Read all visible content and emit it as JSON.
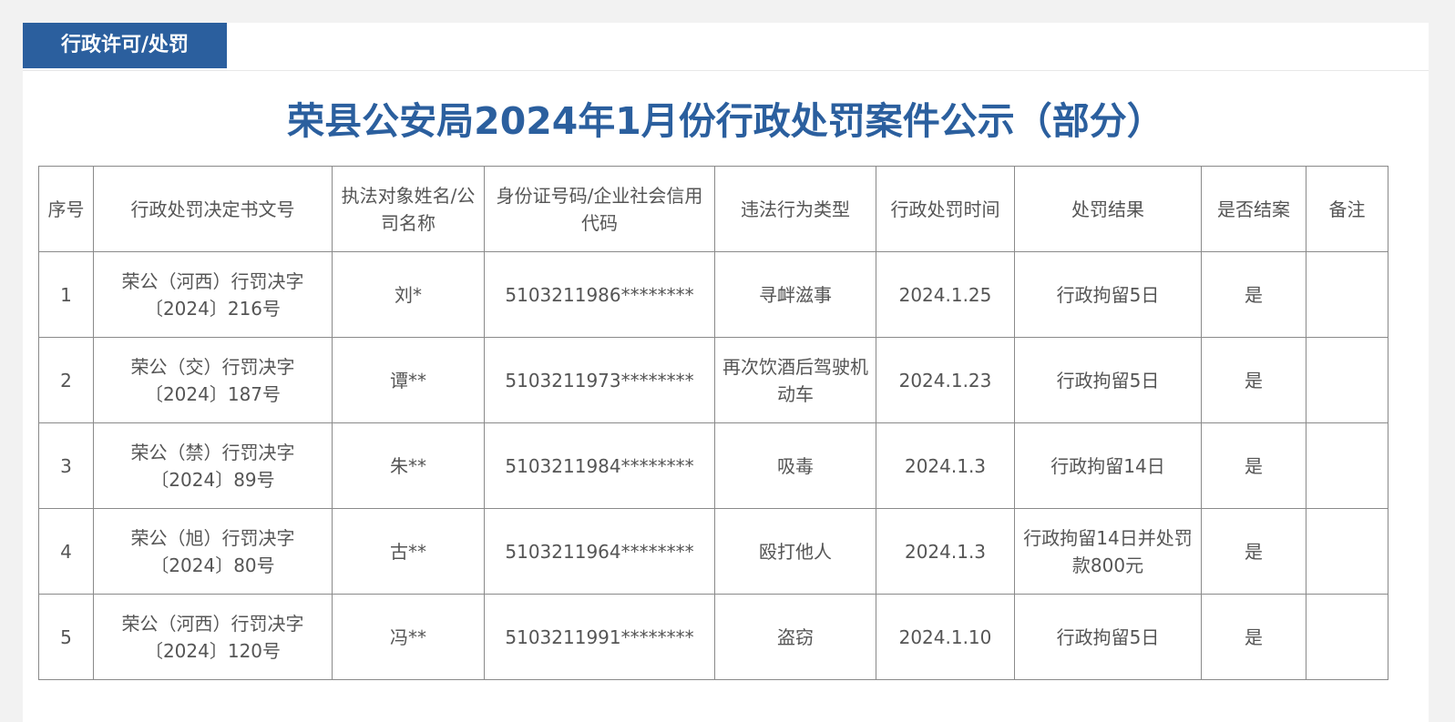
{
  "section": {
    "tab_label": "行政许可/处罚"
  },
  "document": {
    "title": "荣县公安局2024年1月份行政处罚案件公示（部分）"
  },
  "table": {
    "headers": [
      "序号",
      "行政处罚决定书文号",
      "执法对象姓名/公司名称",
      "身份证号码/企业社会信用代码",
      "违法行为类型",
      "行政处罚时间",
      "处罚结果",
      "是否结案",
      "备注"
    ],
    "rows": [
      [
        "1",
        "荣公（河西）行罚决字〔2024〕216号",
        "刘*",
        "5103211986********",
        "寻衅滋事",
        "2024.1.25",
        "行政拘留5日",
        "是",
        ""
      ],
      [
        "2",
        "荣公（交）行罚决字〔2024〕187号",
        "谭**",
        "5103211973********",
        "再次饮酒后驾驶机动车",
        "2024.1.23",
        "行政拘留5日",
        "是",
        ""
      ],
      [
        "3",
        "荣公（禁）行罚决字〔2024〕89号",
        "朱**",
        "5103211984********",
        "吸毒",
        "2024.1.3",
        "行政拘留14日",
        "是",
        ""
      ],
      [
        "4",
        "荣公（旭）行罚决字〔2024〕80号",
        "古**",
        "5103211964********",
        "殴打他人",
        "2024.1.3",
        "行政拘留14日并处罚款800元",
        "是",
        ""
      ],
      [
        "5",
        "荣公（河西）行罚决字〔2024〕120号",
        "冯**",
        "5103211991********",
        "盗窃",
        "2024.1.10",
        "行政拘留5日",
        "是",
        ""
      ]
    ]
  }
}
